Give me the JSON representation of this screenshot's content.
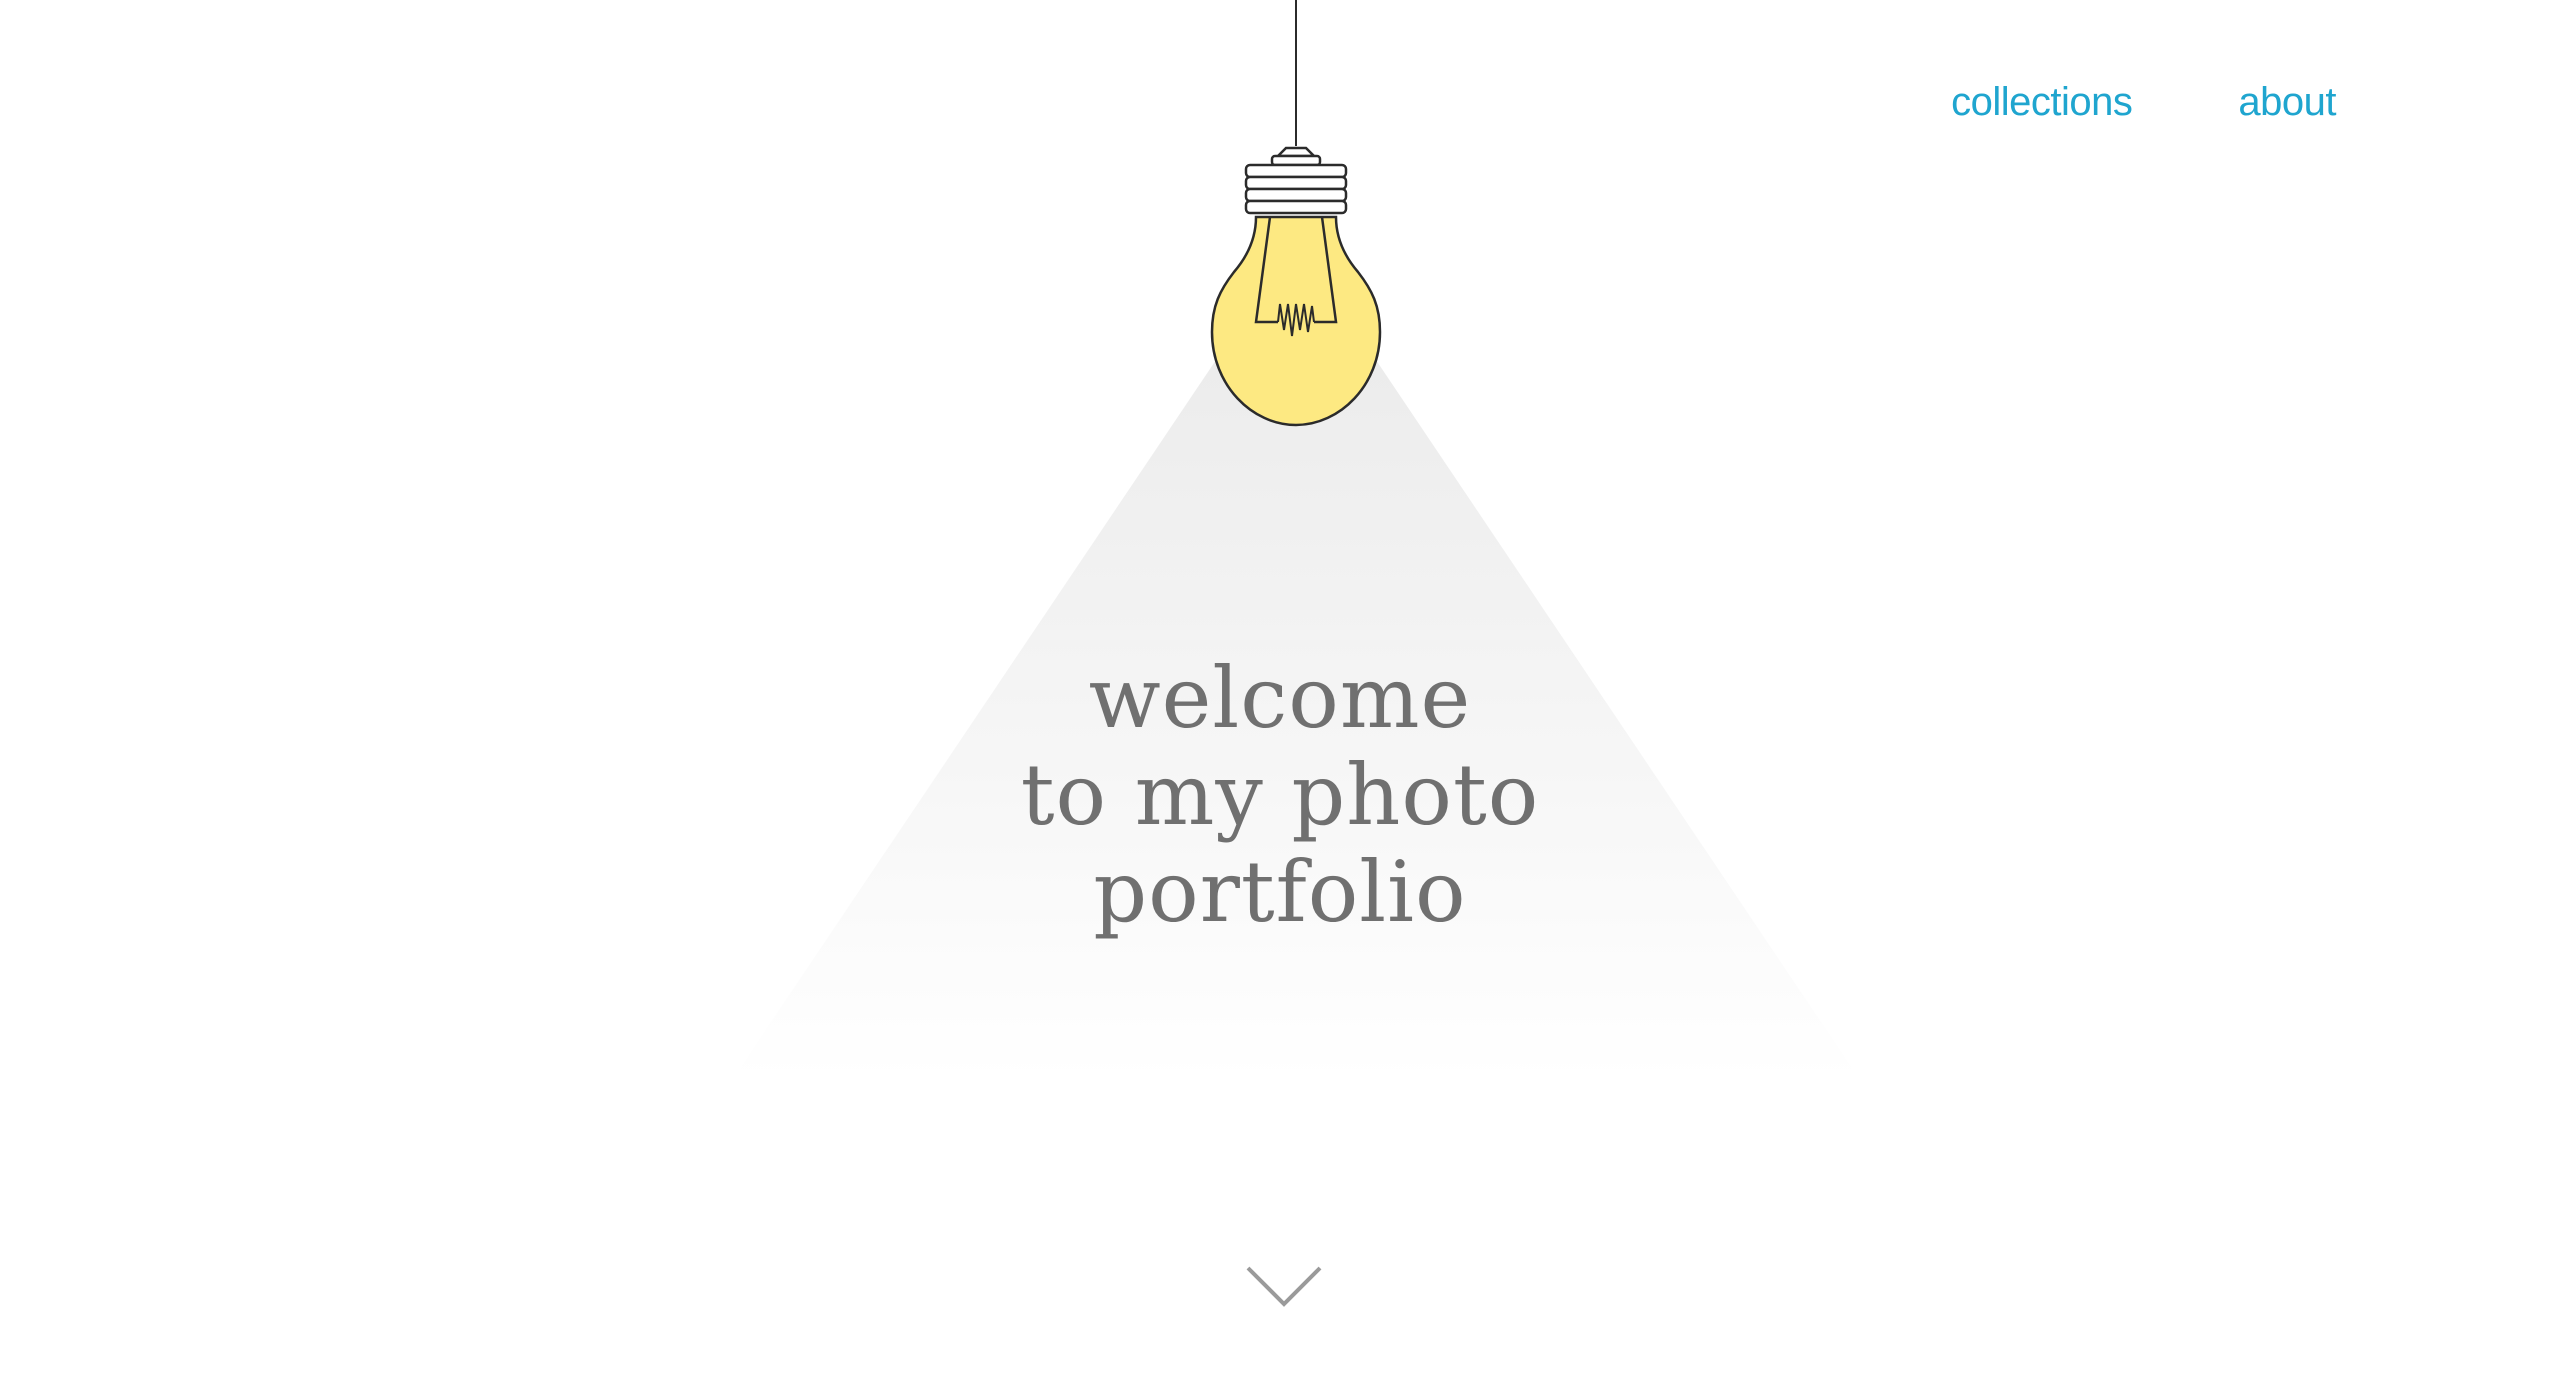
{
  "nav": {
    "links": [
      {
        "label": "collections"
      },
      {
        "label": "about"
      }
    ],
    "link_color": "#1fa5cf"
  },
  "hero": {
    "lines": [
      "welcome",
      "to my photo",
      "portfolio"
    ],
    "text_color": "#707070"
  },
  "bulb": {
    "glass_color": "#fde982",
    "outline_color": "#2b2b2b"
  },
  "icons": {
    "scroll": "chevron-down-icon",
    "lamp": "light-bulb-icon"
  }
}
